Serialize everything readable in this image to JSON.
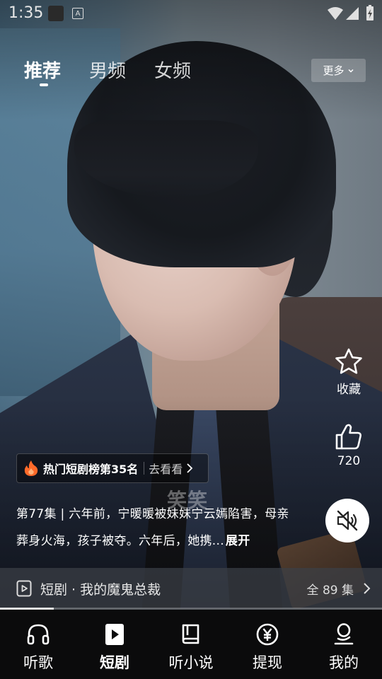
{
  "status_bar": {
    "time": "1:35"
  },
  "top_tabs": [
    {
      "label": "推荐",
      "active": true
    },
    {
      "label": "男频",
      "active": false
    },
    {
      "label": "女频",
      "active": false
    }
  ],
  "more_button": {
    "label": "更多"
  },
  "actions": {
    "favorite_label": "收藏",
    "like_count": "720"
  },
  "hot_chip": {
    "title": "热门短剧榜第35名",
    "go_label": "去看看"
  },
  "description": {
    "text": "第77集 | 六年前，宁暖暖被妹妹宁云嫣陷害，母亲葬身火海，孩子被夺。六年后，她携...",
    "expand_label": "展开"
  },
  "watermark": "笑笑",
  "series": {
    "title": "短剧 · 我的魔鬼总裁",
    "total": "全 89 集",
    "progress": 0.14
  },
  "bottom_nav": [
    {
      "label": "听歌",
      "icon": "headphones-icon",
      "active": false
    },
    {
      "label": "短剧",
      "icon": "play-icon",
      "active": true
    },
    {
      "label": "听小说",
      "icon": "book-icon",
      "active": false
    },
    {
      "label": "提现",
      "icon": "yen-icon",
      "active": false
    },
    {
      "label": "我的",
      "icon": "profile-icon",
      "active": false
    }
  ],
  "colors": {
    "nav_background": "#0b0b0c",
    "fire_orange": "#ff6a2a",
    "text": "#ffffff"
  }
}
